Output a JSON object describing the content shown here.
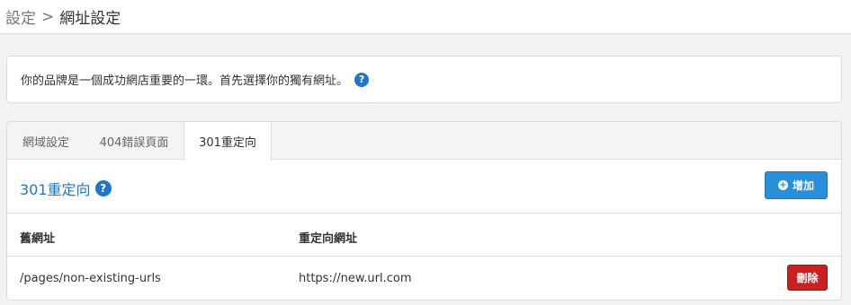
{
  "breadcrumb": {
    "root": "設定",
    "separator": ">",
    "current": "網址設定"
  },
  "info": {
    "text": "你的品牌是一個成功網店重要的一環。首先選擇你的獨有網址。",
    "help_icon": "question-circle-icon"
  },
  "tabs": [
    {
      "label": "網域設定",
      "active": false
    },
    {
      "label": "404錯誤頁面",
      "active": false
    },
    {
      "label": "301重定向",
      "active": true
    }
  ],
  "section": {
    "title": "301重定向",
    "help_icon": "question-circle-icon",
    "add_label": "增加",
    "add_icon": "plus-circle-icon"
  },
  "table": {
    "columns": [
      "舊網址",
      "重定向網址"
    ],
    "rows": [
      {
        "old_url": "/pages/non-existing-urls",
        "new_url": "https://new.url.com",
        "delete_label": "刪除"
      }
    ]
  },
  "colors": {
    "accent": "#1f77c9",
    "add_button": "#2a8fd9",
    "delete_button": "#cc1f1f"
  }
}
